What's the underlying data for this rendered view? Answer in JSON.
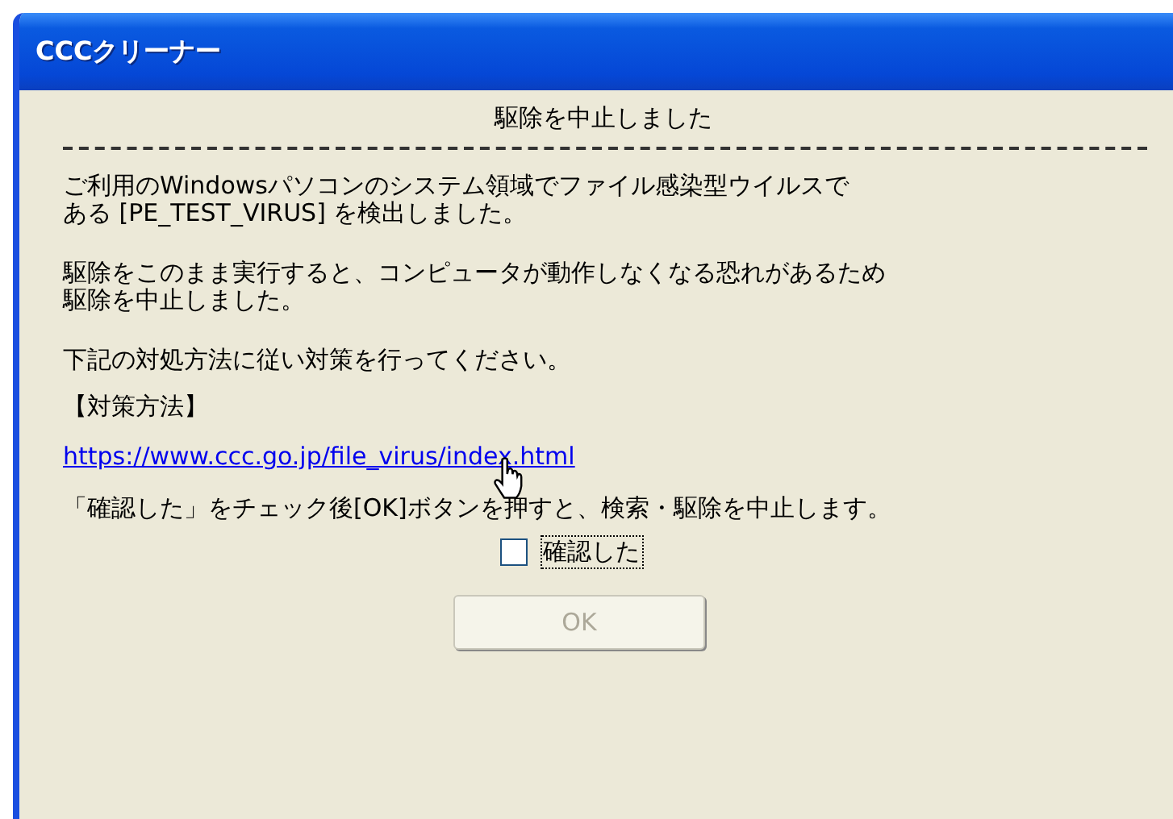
{
  "window": {
    "title": "CCCクリーナー"
  },
  "heading": "駆除を中止しました",
  "paragraphs": [
    {
      "lines": [
        "ご利用のWindowsパソコンのシステム領域でファイル感染型ウイルスで",
        "ある [PE_TEST_VIRUS] を検出しました。"
      ]
    },
    {
      "lines": [
        "駆除をこのまま実行すると、コンピュータが動作しなくなる恐れがあるため",
        "駆除を中止しました。"
      ]
    }
  ],
  "instruction": "下記の対処方法に従い対策を行ってください。",
  "method_label": "【対策方法】",
  "link": "https://www.ccc.go.jp/file_virus/index.html",
  "note": "「確認した」をチェック後[OK]ボタンを押すと、検索・駆除を中止します。",
  "confirm": {
    "label": "確認した",
    "checked": false
  },
  "ok_button": {
    "label": "OK",
    "disabled": true
  }
}
